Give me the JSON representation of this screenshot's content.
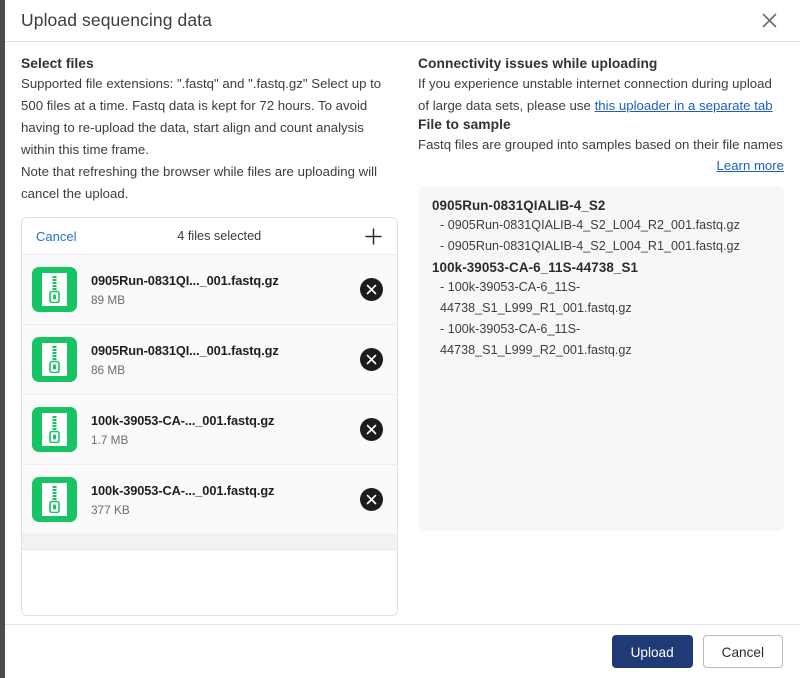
{
  "dialog": {
    "title": "Upload sequencing data",
    "close_icon": "close-icon"
  },
  "left": {
    "section_title": "Select files",
    "paragraph_1": "Supported file extensions: \".fastq\" and \".fastq.gz\" Select up to 500 files at a time. Fastq data is kept for 72 hours. To avoid having to re-upload the data, start align and count analysis within this time frame.",
    "paragraph_2": "Note that refreshing the browser while files are uploading will cancel the upload."
  },
  "uploader": {
    "cancel_label": "Cancel",
    "count_label": "4 files selected",
    "add_icon": "plus-icon",
    "files": [
      {
        "name": "0905Run-0831QI..._001.fastq.gz",
        "size": "89 MB",
        "icon": "zip-file-icon",
        "remove_icon": "remove-circle-icon"
      },
      {
        "name": "0905Run-0831QI..._001.fastq.gz",
        "size": "86 MB",
        "icon": "zip-file-icon",
        "remove_icon": "remove-circle-icon"
      },
      {
        "name": "100k-39053-CA-..._001.fastq.gz",
        "size": "1.7 MB",
        "icon": "zip-file-icon",
        "remove_icon": "remove-circle-icon"
      },
      {
        "name": "100k-39053-CA-..._001.fastq.gz",
        "size": "377 KB",
        "icon": "zip-file-icon",
        "remove_icon": "remove-circle-icon"
      }
    ]
  },
  "right": {
    "connectivity_title": "Connectivity issues while uploading",
    "connectivity_text_before": "If you experience unstable internet connection during upload of large data sets, please use ",
    "connectivity_link": "this uploader in a separate tab",
    "file_to_sample_title": "File to sample",
    "file_to_sample_text": "Fastq files are grouped into samples based on their file names",
    "learn_more": "Learn more",
    "samples": [
      {
        "name": "0905Run-0831QIALIB-4_S2",
        "files": [
          "- 0905Run-0831QIALIB-4_S2_L004_R2_001.fastq.gz",
          "- 0905Run-0831QIALIB-4_S2_L004_R1_001.fastq.gz"
        ]
      },
      {
        "name": "100k-39053-CA-6_11S-44738_S1",
        "files": [
          "- 100k-39053-CA-6_11S-44738_S1_L999_R1_001.fastq.gz",
          "- 100k-39053-CA-6_11S-44738_S1_L999_R2_001.fastq.gz"
        ]
      }
    ]
  },
  "footer": {
    "upload_label": "Upload",
    "cancel_label": "Cancel"
  },
  "colors": {
    "primary_button": "#1f3a75",
    "link": "#1c5fc4",
    "file_icon_green": "#16c464",
    "remove_dark": "#1c1c1c"
  }
}
